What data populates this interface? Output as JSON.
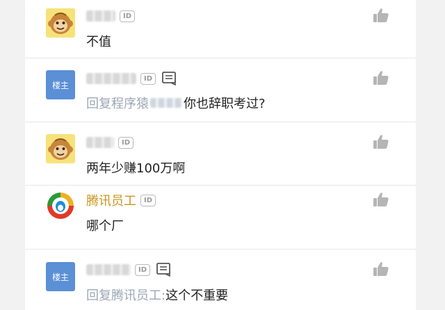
{
  "comments": [
    {
      "avatar": "monkey-avatar",
      "badge": "ID",
      "text": "不值"
    },
    {
      "avatar_label": "楼主",
      "badge": "ID",
      "reply_prefix": "回复程序猿",
      "text": "你也辞职考过?"
    },
    {
      "avatar": "monkey-avatar",
      "badge": "ID",
      "text": "两年少赚100万啊"
    },
    {
      "avatar": "tencent-news-avatar",
      "name": "腾讯员工",
      "badge": "ID",
      "text": "哪个厂"
    },
    {
      "avatar_label": "楼主",
      "badge": "ID",
      "reply_prefix": "回复腾讯员工:",
      "text": "这个不重要"
    }
  ],
  "colors": {
    "verified_name": "#c9951e",
    "reply_prefix": "#9ba7b5",
    "louzhu_avatar": "#5b8fd6",
    "like_icon": "#b5b5b5"
  },
  "icons": [
    "thumbs-up-icon",
    "note-icon",
    "id-badge"
  ]
}
